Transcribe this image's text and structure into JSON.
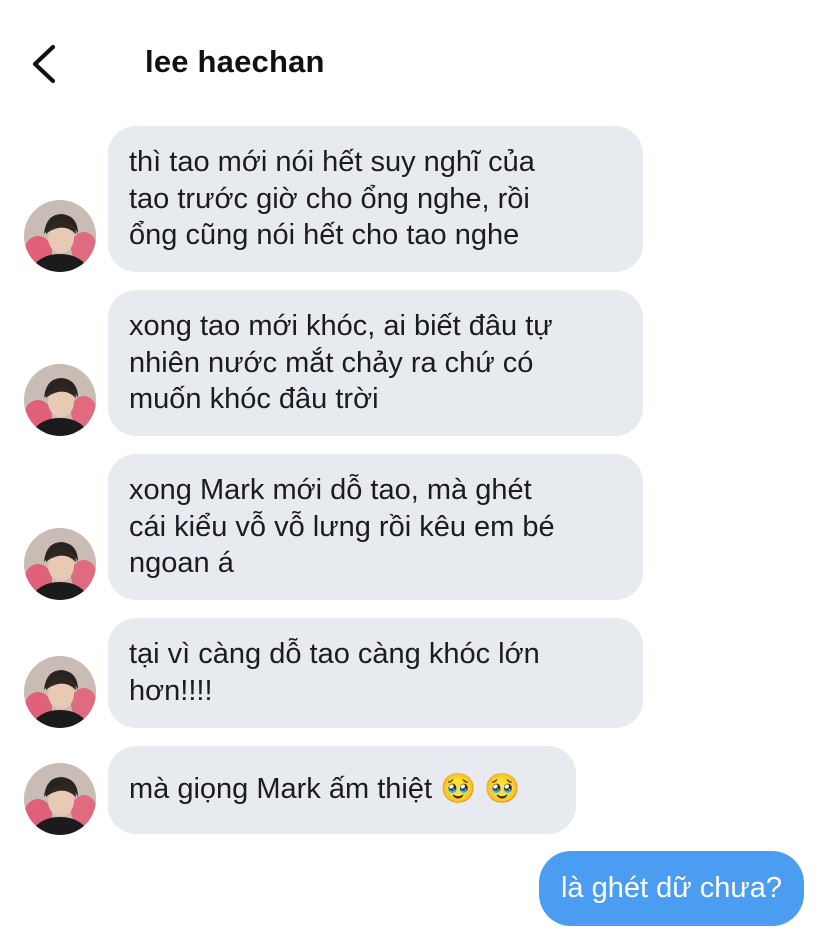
{
  "header": {
    "title": "lee haechan",
    "back_icon": "chevron-left-icon"
  },
  "messages": [
    {
      "lines": [
        "thì tao mới nói hết suy nghĩ của",
        "tao trước giờ cho ổng nghe, rồi",
        "ổng cũng nói hết cho tao nghe"
      ]
    },
    {
      "lines": [
        "xong tao mới khóc, ai biết đâu tự",
        "nhiên nước mắt chảy ra chứ có",
        "muốn khóc đâu trời"
      ]
    },
    {
      "lines": [
        "xong Mark mới dỗ tao, mà ghét",
        "cái kiểu vỗ vỗ lưng rồi kêu em bé",
        "ngoan á"
      ]
    },
    {
      "lines": [
        "tại vì càng dỗ tao càng khóc lớn",
        "hơn!!!!"
      ]
    },
    {
      "lines": [
        "mà giọng Mark ấm thiệt 🥹 🥹"
      ]
    }
  ],
  "outgoing": {
    "text": "là ghét dữ chưa?"
  },
  "colors": {
    "incoming_bubble": "#e7eaee",
    "outgoing_bubble": "#4a9df0",
    "outgoing_text": "#ffffff"
  }
}
